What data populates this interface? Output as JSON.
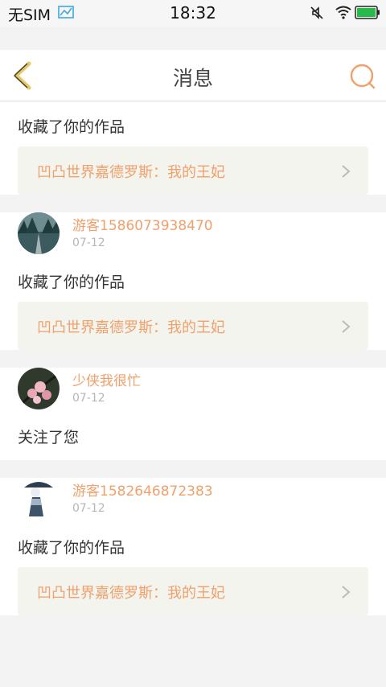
{
  "status": {
    "carrier": "无SIM",
    "time": "18:32"
  },
  "header": {
    "title": "消息"
  },
  "messages": [
    {
      "action": "收藏了你的作品",
      "work": "凹凸世界嘉德罗斯：我的王妃"
    },
    {
      "user": "游客1586073938470",
      "date": "07-12",
      "action": "收藏了你的作品",
      "work": "凹凸世界嘉德罗斯：我的王妃"
    },
    {
      "user": "少侠我很忙",
      "date": "07-12",
      "action": "关注了您"
    },
    {
      "user": "游客1582646872383",
      "date": "07-12",
      "action": "收藏了你的作品",
      "work": "凹凸世界嘉德罗斯：我的王妃"
    }
  ],
  "colors": {
    "accent": "#f0a06b",
    "back_arrow": "#e5c86a"
  }
}
